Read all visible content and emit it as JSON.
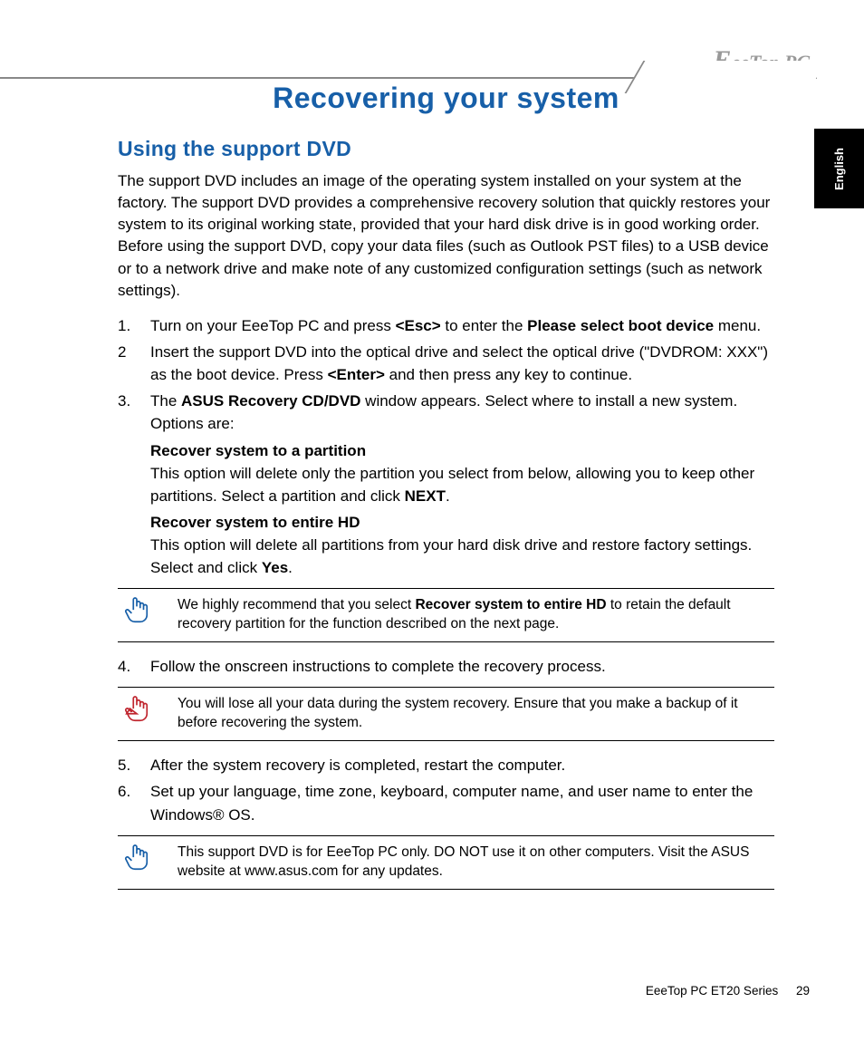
{
  "logo": "EeeTop PC",
  "language_tab": "English",
  "title": "Recovering your system",
  "section": "Using the support DVD",
  "intro": "The support DVD includes an image of the operating system installed on your system at the factory. The support DVD provides a comprehensive recovery solution that quickly restores your system to its original working state, provided that your hard disk drive is in good working order. Before using the support DVD, copy your data files (such as Outlook PST files) to a USB device or to a network drive and make note of any customized configuration settings (such as network settings).",
  "steps": {
    "s1": {
      "num": "1.",
      "a": "Turn on your EeeTop PC and press ",
      "b": "<Esc>",
      "c": " to enter the ",
      "d": "Please select boot device",
      "e": " menu."
    },
    "s2": {
      "num": "2",
      "a": "Insert the support DVD into the optical drive and select the optical drive (\"DVDROM: XXX\") as the boot device. Press ",
      "b": "<Enter>",
      "c": " and then press any key to continue."
    },
    "s3": {
      "num": "3.",
      "a": "The ",
      "b": "ASUS Recovery CD/DVD",
      "c": " window appears. Select where to install a new system. Options are:",
      "opt1_h": "Recover system to a partition",
      "opt1_t1": "This option will delete only the partition you select from below, allowing you to keep other partitions. Select a partition and click ",
      "opt1_b": "NEXT",
      "opt1_t2": ".",
      "opt2_h": "Recover system to entire HD",
      "opt2_t1": "This option will delete all partitions from your hard disk drive and restore factory settings. Select and click ",
      "opt2_b": "Yes",
      "opt2_t2": "."
    },
    "s4": {
      "num": "4.",
      "a": "Follow the onscreen instructions to complete the recovery process."
    },
    "s5": {
      "num": "5.",
      "a": "After the system recovery is completed, restart the computer."
    },
    "s6": {
      "num": "6.",
      "a": "Set up your language, time zone, keyboard, computer name, and user name to enter the Windows® OS."
    }
  },
  "notes": {
    "n1": {
      "a": "We highly recommend that you select ",
      "b": "Recover system to entire HD",
      "c": " to retain the default recovery partition for the function described on the next page."
    },
    "n2": "You will lose all your data during the system recovery. Ensure that you make a backup of it before recovering the system.",
    "n3": "This support DVD is for EeeTop PC only. DO NOT use it on other computers. Visit the ASUS website at www.asus.com for any updates."
  },
  "footer": {
    "series": "EeeTop PC ET20 Series",
    "page": "29"
  }
}
